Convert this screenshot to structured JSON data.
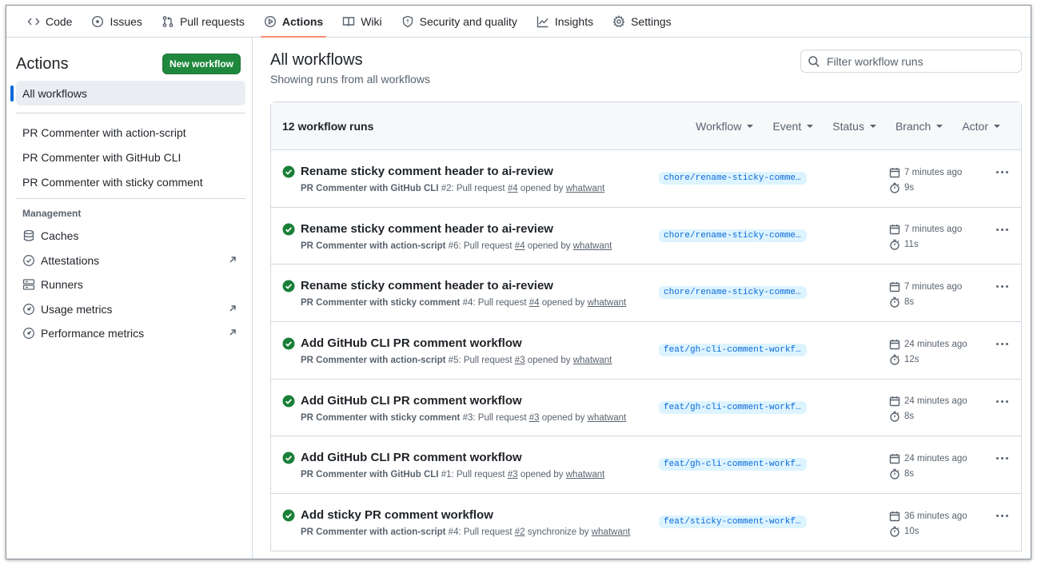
{
  "topnav": {
    "tabs": [
      {
        "label": "Code",
        "icon": "code-icon"
      },
      {
        "label": "Issues",
        "icon": "issue-icon"
      },
      {
        "label": "Pull requests",
        "icon": "pull-request-icon"
      },
      {
        "label": "Actions",
        "icon": "play-icon",
        "active": true
      },
      {
        "label": "Wiki",
        "icon": "book-icon"
      },
      {
        "label": "Security and quality",
        "icon": "shield-icon"
      },
      {
        "label": "Insights",
        "icon": "graph-icon"
      },
      {
        "label": "Settings",
        "icon": "gear-icon"
      }
    ]
  },
  "sidebar": {
    "title": "Actions",
    "new_workflow_label": "New workflow",
    "all_workflows_label": "All workflows",
    "workflows": [
      "PR Commenter with action-script",
      "PR Commenter with GitHub CLI",
      "PR Commenter with sticky comment"
    ],
    "management_heading": "Management",
    "management": [
      {
        "label": "Caches",
        "icon": "database-icon",
        "external": false
      },
      {
        "label": "Attestations",
        "icon": "verified-icon",
        "external": true
      },
      {
        "label": "Runners",
        "icon": "server-icon",
        "external": false
      },
      {
        "label": "Usage metrics",
        "icon": "meter-icon",
        "external": true
      },
      {
        "label": "Performance metrics",
        "icon": "meter-icon",
        "external": true
      }
    ]
  },
  "main": {
    "title": "All workflows",
    "subtitle": "Showing runs from all workflows",
    "filter_placeholder": "Filter workflow runs",
    "runs_count": "12 workflow runs",
    "filters": [
      "Workflow",
      "Event",
      "Status",
      "Branch",
      "Actor"
    ],
    "runs": [
      {
        "title": "Rename sticky comment header to ai-review",
        "workflow": "PR Commenter with GitHub CLI",
        "run": "#2",
        "event": "Pull request",
        "pr": "#4",
        "action": "opened by",
        "actor": "whatwant",
        "branch": "chore/rename-sticky-comment-header",
        "time": "7 minutes ago",
        "duration": "9s"
      },
      {
        "title": "Rename sticky comment header to ai-review",
        "workflow": "PR Commenter with action-script",
        "run": "#6",
        "event": "Pull request",
        "pr": "#4",
        "action": "opened by",
        "actor": "whatwant",
        "branch": "chore/rename-sticky-comment-header",
        "time": "7 minutes ago",
        "duration": "11s"
      },
      {
        "title": "Rename sticky comment header to ai-review",
        "workflow": "PR Commenter with sticky comment",
        "run": "#4",
        "event": "Pull request",
        "pr": "#4",
        "action": "opened by",
        "actor": "whatwant",
        "branch": "chore/rename-sticky-comment-header",
        "time": "7 minutes ago",
        "duration": "8s"
      },
      {
        "title": "Add GitHub CLI PR comment workflow",
        "workflow": "PR Commenter with action-script",
        "run": "#5",
        "event": "Pull request",
        "pr": "#3",
        "action": "opened by",
        "actor": "whatwant",
        "branch": "feat/gh-cli-comment-workflow",
        "time": "24 minutes ago",
        "duration": "12s"
      },
      {
        "title": "Add GitHub CLI PR comment workflow",
        "workflow": "PR Commenter with sticky comment",
        "run": "#3",
        "event": "Pull request",
        "pr": "#3",
        "action": "opened by",
        "actor": "whatwant",
        "branch": "feat/gh-cli-comment-workflow",
        "time": "24 minutes ago",
        "duration": "8s"
      },
      {
        "title": "Add GitHub CLI PR comment workflow",
        "workflow": "PR Commenter with GitHub CLI",
        "run": "#1",
        "event": "Pull request",
        "pr": "#3",
        "action": "opened by",
        "actor": "whatwant",
        "branch": "feat/gh-cli-comment-workflow",
        "time": "24 minutes ago",
        "duration": "8s"
      },
      {
        "title": "Add sticky PR comment workflow",
        "workflow": "PR Commenter with action-script",
        "run": "#4",
        "event": "Pull request",
        "pr": "#2",
        "action": "synchronize by",
        "actor": "whatwant",
        "branch": "feat/sticky-comment-workflow",
        "time": "36 minutes ago",
        "duration": "10s"
      }
    ]
  },
  "colors": {
    "accent": "#0969da",
    "success": "#1a7f37",
    "primary_button": "#1f883d",
    "active_tab_underline": "#fd8c73"
  }
}
